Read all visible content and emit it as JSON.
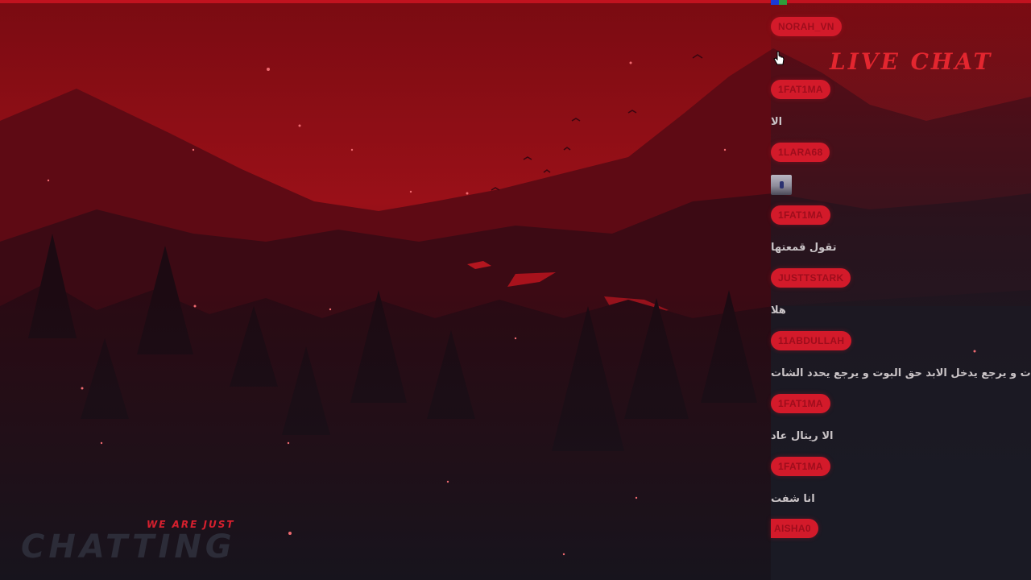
{
  "overlay": {
    "brand_small": "WE ARE JUST",
    "brand_big": "CHATTING",
    "live_chat_title": "LIVE CHAT"
  },
  "chat": {
    "rows": [
      {
        "kind": "badge",
        "user": "NORAH_VN"
      },
      {
        "kind": "badge",
        "user": "1FAT1MA"
      },
      {
        "kind": "text",
        "text": "الا"
      },
      {
        "kind": "badge",
        "user": "1LARA68"
      },
      {
        "kind": "image",
        "alt": ""
      },
      {
        "kind": "badge",
        "user": "1FAT1MA"
      },
      {
        "kind": "text",
        "text": "تقول قمعتها"
      },
      {
        "kind": "badge",
        "user": "JUSTTSTARK"
      },
      {
        "kind": "text",
        "text": "هلا"
      },
      {
        "kind": "badge",
        "user": "11ABDULLAH"
      },
      {
        "kind": "text",
        "text": "يات و يرجع يدخل الابد حق البوت و يرجع يحدد الشات"
      },
      {
        "kind": "badge",
        "user": "1FAT1MA"
      },
      {
        "kind": "text",
        "text": "الا ريتال عاد"
      },
      {
        "kind": "badge",
        "user": "1FAT1MA"
      },
      {
        "kind": "text",
        "text": "انا شفت"
      },
      {
        "kind": "badge",
        "user": "AISHA0"
      }
    ]
  },
  "colors": {
    "accent": "#d31a2a",
    "badge_text": "#9e0d1c",
    "sky_top": "#7a0b12",
    "sky_mid": "#a0111a",
    "chat_bg": "#1b1a24"
  },
  "icons": {
    "cursor": "hand-pointer-icon"
  }
}
